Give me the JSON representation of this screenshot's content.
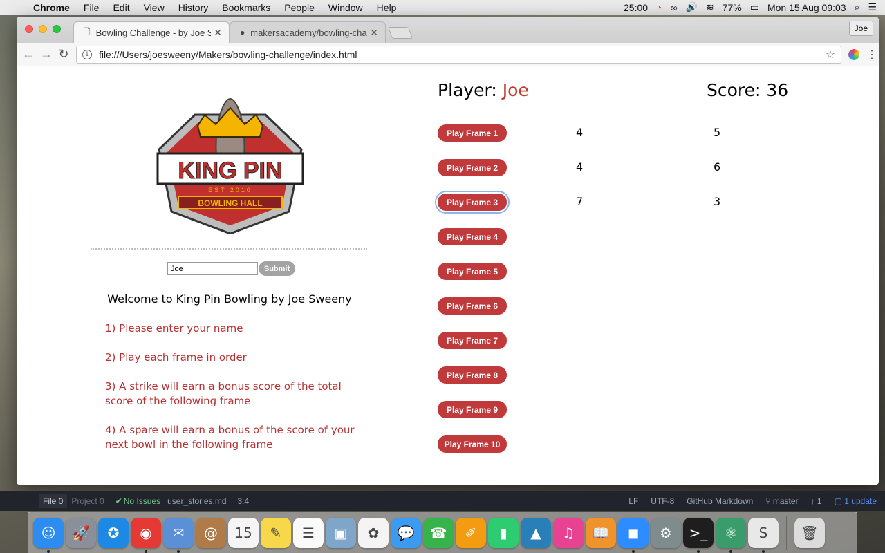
{
  "menubar": {
    "app_name": "Chrome",
    "items": [
      "File",
      "Edit",
      "View",
      "History",
      "Bookmarks",
      "People",
      "Window",
      "Help"
    ],
    "timer": "25:00",
    "battery": "77%",
    "datetime": "Mon 15 Aug  09:03"
  },
  "browser": {
    "tabs": [
      {
        "title": "Bowling Challenge - by Joe Sw",
        "icon": "document-icon"
      },
      {
        "title": "makersacademy/bowling-challe",
        "icon": "github-icon"
      }
    ],
    "profile": "Joe",
    "url": "file:///Users/joesweeny/Makers/bowling-challenge/index.html"
  },
  "page": {
    "logo": {
      "title": "KING PIN",
      "est": "EST 2010",
      "subtitle": "BOWLING HALL"
    },
    "name_input_value": "Joe",
    "submit_label": "Submit",
    "welcome": "Welcome to King Pin Bowling by Joe Sweeny",
    "instructions": [
      "1) Please enter your name",
      "2) Play each frame in order",
      "3) A strike will earn a bonus score of the total score of the following frame",
      "4) A spare will earn a bonus of the score of your next bowl in the following frame"
    ],
    "player_label": "Player:",
    "player_name": "Joe",
    "score_label": "Score:",
    "score_value": "36",
    "frames": [
      {
        "label": "Play Frame 1",
        "roll1": "4",
        "roll2": "5"
      },
      {
        "label": "Play Frame 2",
        "roll1": "4",
        "roll2": "6"
      },
      {
        "label": "Play Frame 3",
        "roll1": "7",
        "roll2": "3"
      },
      {
        "label": "Play Frame 4",
        "roll1": "",
        "roll2": ""
      },
      {
        "label": "Play Frame 5",
        "roll1": "",
        "roll2": ""
      },
      {
        "label": "Play Frame 6",
        "roll1": "",
        "roll2": ""
      },
      {
        "label": "Play Frame 7",
        "roll1": "",
        "roll2": ""
      },
      {
        "label": "Play Frame 8",
        "roll1": "",
        "roll2": ""
      },
      {
        "label": "Play Frame 9",
        "roll1": "",
        "roll2": ""
      },
      {
        "label": "Play Frame 10",
        "roll1": "",
        "roll2": ""
      }
    ],
    "colors": {
      "accent": "#c0393b",
      "player_name": "#c0392b",
      "instructions": "#b83232",
      "submit": "#a3a3a3"
    }
  },
  "statusbar": {
    "file_tab": "File 0",
    "project_tab": "Project 0",
    "issues": "No Issues",
    "filename": "user_stories.md",
    "cursor": "3:4",
    "line_ending": "LF",
    "encoding": "UTF-8",
    "grammar": "GitHub Markdown",
    "branch": "master",
    "ahead": "1",
    "update": "1 update"
  },
  "dock": [
    {
      "name": "finder-icon",
      "glyph": "☺",
      "color": "#2d8cf0",
      "running": true
    },
    {
      "name": "launchpad-icon",
      "glyph": "🚀",
      "color": "#8a8f99",
      "running": false
    },
    {
      "name": "safari-icon",
      "glyph": "✪",
      "color": "#1e88e5",
      "running": false
    },
    {
      "name": "chrome-icon",
      "glyph": "◉",
      "color": "#e53935",
      "running": true
    },
    {
      "name": "mail-icon",
      "glyph": "✉",
      "color": "#5b8fd6",
      "running": true
    },
    {
      "name": "contacts-icon",
      "glyph": "@",
      "color": "#b07b48",
      "running": false
    },
    {
      "name": "calendar-icon",
      "glyph": "15",
      "color": "#f5f5f5",
      "running": false
    },
    {
      "name": "notes-icon",
      "glyph": "✎",
      "color": "#f7d84a",
      "running": false
    },
    {
      "name": "reminders-icon",
      "glyph": "☰",
      "color": "#fafafa",
      "running": false
    },
    {
      "name": "preview-icon",
      "glyph": "▣",
      "color": "#7fa6c9",
      "running": false
    },
    {
      "name": "photos-icon",
      "glyph": "✿",
      "color": "#f4f4f4",
      "running": false
    },
    {
      "name": "messages-icon",
      "glyph": "💬",
      "color": "#3a9bf0",
      "running": false
    },
    {
      "name": "facetime-icon",
      "glyph": "☎",
      "color": "#36b34a",
      "running": false
    },
    {
      "name": "pages-icon",
      "glyph": "✐",
      "color": "#f39c12",
      "running": false
    },
    {
      "name": "numbers-icon",
      "glyph": "▮",
      "color": "#2ecc71",
      "running": false
    },
    {
      "name": "keynote-icon",
      "glyph": "▲",
      "color": "#2980b9",
      "running": false
    },
    {
      "name": "itunes-icon",
      "glyph": "♫",
      "color": "#e84393",
      "running": false
    },
    {
      "name": "ibooks-icon",
      "glyph": "📖",
      "color": "#f0932b",
      "running": false
    },
    {
      "name": "zoom-icon",
      "glyph": "◼",
      "color": "#2d8cff",
      "running": true
    },
    {
      "name": "system-preferences-icon",
      "glyph": "⚙",
      "color": "#7f8c8d",
      "running": false
    },
    {
      "name": "terminal-icon",
      "glyph": ">_",
      "color": "#1e1e1e",
      "running": true
    },
    {
      "name": "atom-icon",
      "glyph": "⚛",
      "color": "#3a9c6a",
      "running": true
    },
    {
      "name": "slack-icon",
      "glyph": "S",
      "color": "#e8e8e8",
      "running": true
    },
    {
      "name": "trash-icon",
      "glyph": "🗑",
      "color": "#dcdcdc",
      "running": false
    }
  ]
}
